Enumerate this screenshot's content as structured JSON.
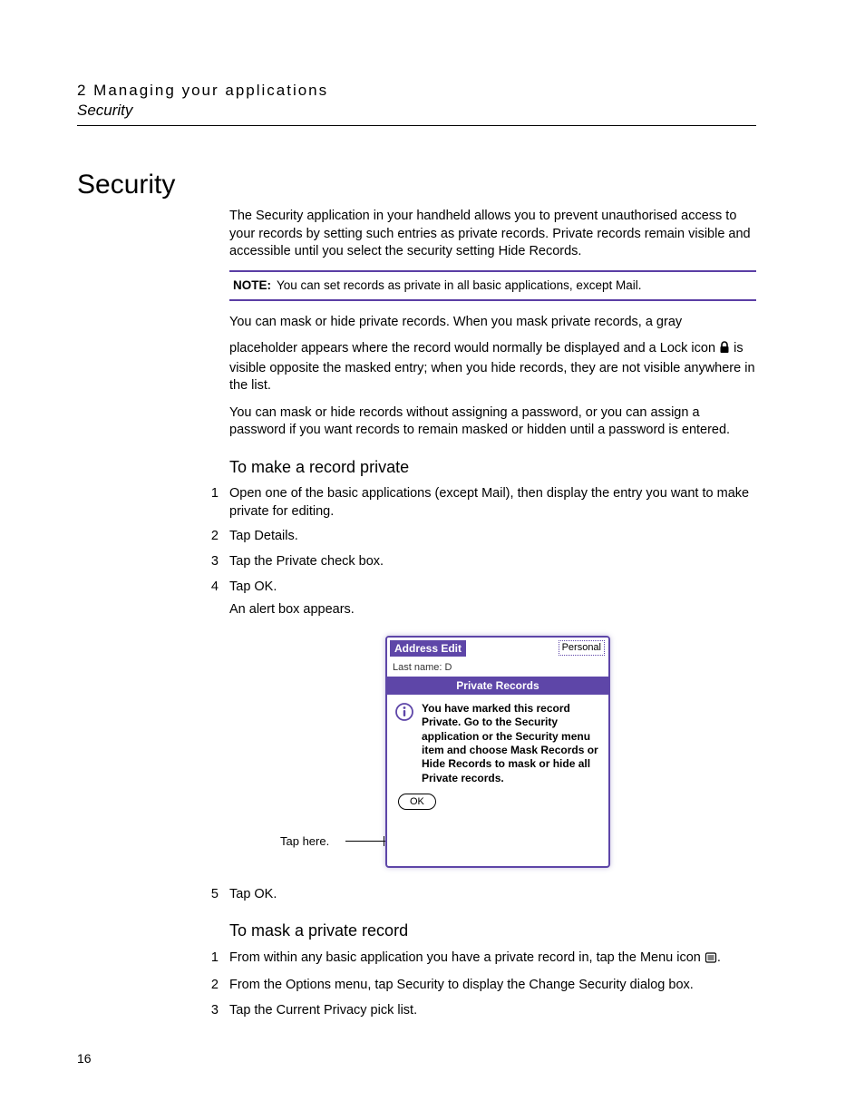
{
  "header": {
    "chapter_line": "2 Managing your applications",
    "section_line": "Security"
  },
  "title": "Security",
  "intro_para": "The Security application in your handheld allows you to prevent unauthorised access to your records by setting such entries as private records. Private records remain visible and accessible until you select the security setting Hide Records.",
  "note": {
    "label": "NOTE:",
    "text": "You can set records as private in all basic applications, except Mail."
  },
  "mask_para1_line1": "You can mask or hide private records. When you mask private records, a gray",
  "mask_para1_line2a": "placeholder appears where the record would normally be displayed and a Lock icon ",
  "mask_para1_line2b": " is visible opposite the masked entry; when you hide records, they are not visible anywhere in the list.",
  "mask_para2": "You can mask or hide records without assigning a password, or you can assign a password if you want records to remain masked or hidden until a password is entered.",
  "section1": {
    "heading": "To make a record private",
    "items": [
      {
        "n": "1",
        "text": "Open one of the basic applications (except Mail), then display the entry you want to make private for editing."
      },
      {
        "n": "2",
        "text": "Tap Details."
      },
      {
        "n": "3",
        "text": "Tap the Private check box."
      },
      {
        "n": "4",
        "text": "Tap OK.",
        "followup": "An alert box appears."
      }
    ],
    "after_item_n": "5",
    "after_item_text": "Tap OK."
  },
  "dialog": {
    "title": "Address Edit",
    "category": "Personal",
    "field_prefix": "Last name: D",
    "banner": "Private Records",
    "message": "You have marked this record Private.  Go to the Security application or the Security menu item  and choose Mask Records or Hide Records to mask or hide all Private records.",
    "ok_label": "OK",
    "callout": "Tap here."
  },
  "section2": {
    "heading": "To mask a private record",
    "items": [
      {
        "n": "1",
        "text_a": "From within any basic application you have a private record in, tap the Menu icon ",
        "text_b": "."
      },
      {
        "n": "2",
        "text": "From the Options menu, tap Security to display the Change Security dialog box."
      },
      {
        "n": "3",
        "text": "Tap the Current Privacy pick list."
      }
    ]
  },
  "page_number": "16"
}
